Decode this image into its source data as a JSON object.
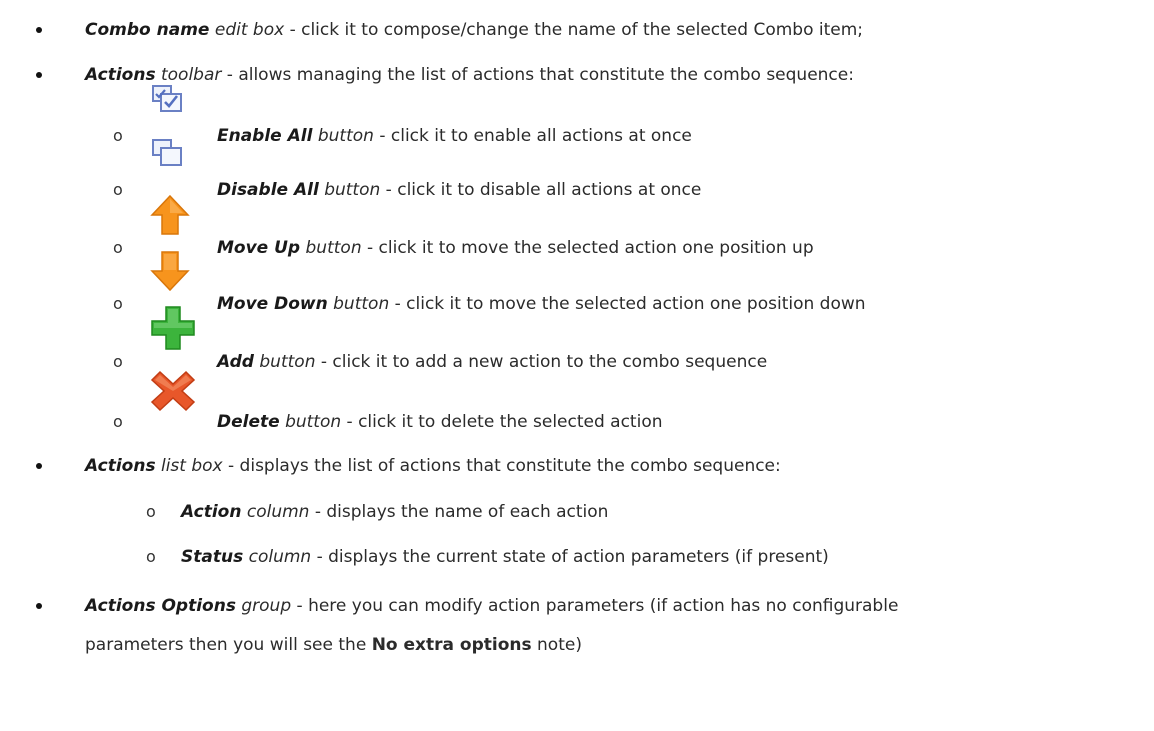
{
  "items": [
    {
      "term": "Combo name",
      "kind": "edit box",
      "desc": " - click it to compose/change the name of the selected Combo item;"
    },
    {
      "term": "Actions",
      "kind": "toolbar",
      "desc": " - allows managing the list of actions that constitute the combo sequence:",
      "buttons": [
        {
          "icon": "enable-all-icon",
          "term": "Enable All",
          "kind": "button",
          "desc": " - click it to enable all actions at once"
        },
        {
          "icon": "disable-all-icon",
          "term": "Disable All",
          "kind": "button",
          "desc": " - click it to disable all actions at once"
        },
        {
          "icon": "move-up-arrow-icon",
          "term": "Move Up",
          "kind": "button",
          "desc": " - click it to move the selected action one position up"
        },
        {
          "icon": "move-down-arrow-icon",
          "term": "Move Down",
          "kind": "button",
          "desc": " - click it to move the selected action one position down"
        },
        {
          "icon": "add-plus-icon",
          "term": "Add",
          "kind": "button",
          "desc": " - click it to add a new action to the combo sequence"
        },
        {
          "icon": "delete-cross-icon",
          "term": "Delete",
          "kind": "button",
          "desc": " - click it to delete the selected action"
        }
      ]
    },
    {
      "term": "Actions",
      "kind": "list box",
      "desc": " - displays the list of actions that constitute the combo sequence:",
      "columns": [
        {
          "term": "Action",
          "kind": "column",
          "desc": " - displays the name of each action"
        },
        {
          "term": "Status",
          "kind": "column",
          "desc": " - displays the current state of action parameters (if present)"
        }
      ]
    },
    {
      "term": "Actions Options",
      "kind": "group",
      "desc_line1": " - here you can modify action parameters (if action has no configurable",
      "desc_line2_before": "parameters then you will see the ",
      "desc_line2_strong": "No extra options",
      "desc_line2_after": " note)"
    }
  ],
  "glyphs": {
    "sub_bullet": "o"
  },
  "colors": {
    "text": "#2b2b2b",
    "up_arrow": "#f7941d",
    "add_plus": "#3cb43c",
    "delete_cross": "#e8572a"
  }
}
